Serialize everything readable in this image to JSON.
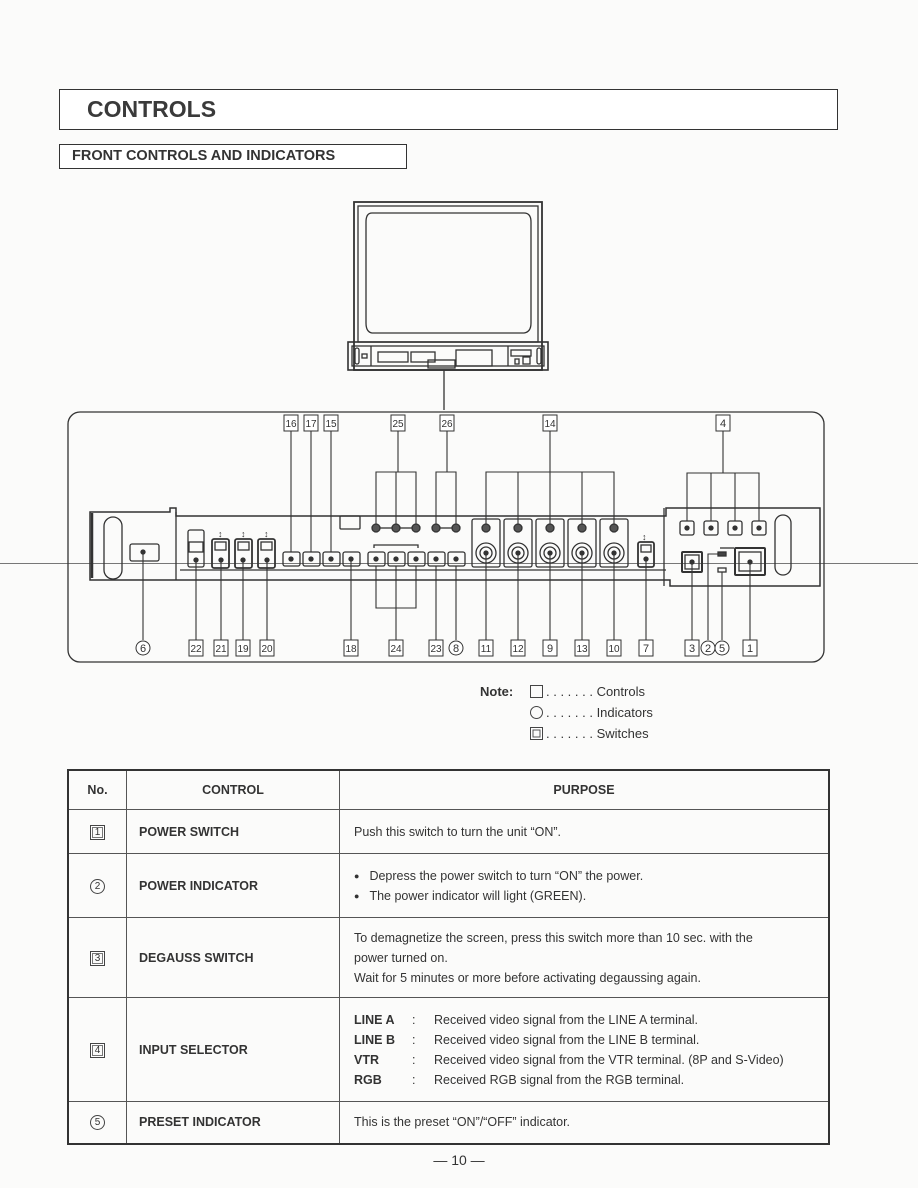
{
  "header": {
    "title": "CONTROLS",
    "subtitle": "FRONT CONTROLS AND INDICATORS"
  },
  "diagram": {
    "top_callouts": [
      {
        "num": "16",
        "shape": "box"
      },
      {
        "num": "17",
        "shape": "box"
      },
      {
        "num": "15",
        "shape": "box"
      },
      {
        "num": "25",
        "shape": "box"
      },
      {
        "num": "26",
        "shape": "box"
      },
      {
        "num": "14",
        "shape": "box"
      },
      {
        "num": "4",
        "shape": "box"
      }
    ],
    "bottom_callouts": [
      {
        "num": "6",
        "shape": "circle"
      },
      {
        "num": "22",
        "shape": "box"
      },
      {
        "num": "21",
        "shape": "box"
      },
      {
        "num": "19",
        "shape": "box"
      },
      {
        "num": "20",
        "shape": "box"
      },
      {
        "num": "18",
        "shape": "box"
      },
      {
        "num": "24",
        "shape": "box"
      },
      {
        "num": "23",
        "shape": "box"
      },
      {
        "num": "8",
        "shape": "circle"
      },
      {
        "num": "11",
        "shape": "box"
      },
      {
        "num": "12",
        "shape": "box"
      },
      {
        "num": "9",
        "shape": "box"
      },
      {
        "num": "13",
        "shape": "box"
      },
      {
        "num": "10",
        "shape": "box"
      },
      {
        "num": "7",
        "shape": "box"
      },
      {
        "num": "3",
        "shape": "box"
      },
      {
        "num": "2",
        "shape": "circle"
      },
      {
        "num": "5",
        "shape": "circle"
      },
      {
        "num": "1",
        "shape": "box"
      }
    ]
  },
  "note": {
    "label": "Note:",
    "items": [
      {
        "symbol": "square",
        "text": ". . . . . . . Controls"
      },
      {
        "symbol": "circle",
        "text": ". . . . . . . Indicators"
      },
      {
        "symbol": "switch",
        "text": ". . . . . . . Switches"
      }
    ]
  },
  "table": {
    "headers": {
      "no": "No.",
      "control": "CONTROL",
      "purpose": "PURPOSE"
    },
    "rows": [
      {
        "no": "1",
        "no_shape": "box",
        "control": "POWER SWITCH",
        "purpose": [
          "Push this switch to turn the unit “ON”."
        ]
      },
      {
        "no": "2",
        "no_shape": "circle",
        "control": "POWER INDICATOR",
        "bullets": [
          "Depress the power switch to turn “ON” the power.",
          "The power indicator will light (GREEN)."
        ]
      },
      {
        "no": "3",
        "no_shape": "box",
        "control": "DEGAUSS SWITCH",
        "purpose": [
          "To demagnetize the screen, press this switch more than 10 sec. with the",
          "power turned on.",
          "Wait for 5 minutes or more before activating degaussing again."
        ]
      },
      {
        "no": "4",
        "no_shape": "box",
        "control": "INPUT SELECTOR",
        "selectors": [
          {
            "key": "LINE A",
            "text": "Received video signal from the LINE A terminal."
          },
          {
            "key": "LINE B",
            "text": "Received video signal from the LINE B terminal."
          },
          {
            "key": "VTR",
            "text": "Received video signal from the VTR terminal. (8P and S-Video)"
          },
          {
            "key": "RGB",
            "text": "Received RGB signal from the RGB terminal."
          }
        ]
      },
      {
        "no": "5",
        "no_shape": "circle",
        "control": "PRESET INDICATOR",
        "purpose": [
          "This is the preset “ON”/“OFF” indicator."
        ]
      }
    ]
  },
  "footer": {
    "page": "— 10 —"
  }
}
